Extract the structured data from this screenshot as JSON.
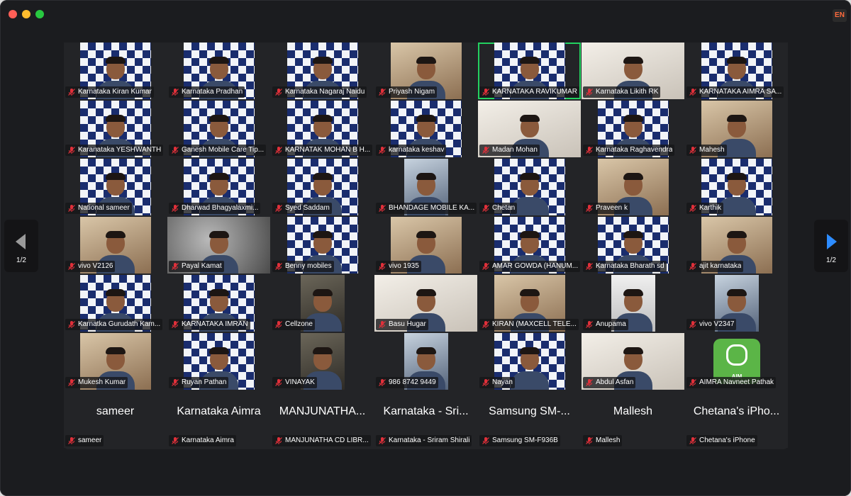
{
  "language_badge": "EN",
  "colors": {
    "mute_icon": "#e0303a",
    "active_speaker": "#23d160",
    "next_arrow": "#2d8cff",
    "prev_arrow": "#9a9a9a"
  },
  "pager": {
    "prev_page": "1/2",
    "next_page": "1/2"
  },
  "participants": [
    {
      "name": "Karnataka Kiran Kumar",
      "bg": "pattern"
    },
    {
      "name": "Karnataka Pradhan",
      "bg": "pattern"
    },
    {
      "name": "Karnataka Nagaraj Naidu",
      "bg": "pattern"
    },
    {
      "name": "Priyash Nigam",
      "bg": "warm"
    },
    {
      "name": "KARNATAKA RAVIKUMAR",
      "bg": "pattern",
      "speaking": true
    },
    {
      "name": "Karnataka Likith RK",
      "bg": "bright"
    },
    {
      "name": "KARNATAKA AIMRA SA...",
      "bg": "pattern"
    },
    {
      "name": "Karanataka YESHWANTH",
      "bg": "pattern"
    },
    {
      "name": "Ganesh Mobile Care Tip...",
      "bg": "pattern"
    },
    {
      "name": "KARNATAK MOHAN B H...",
      "bg": "pattern"
    },
    {
      "name": "karnataka keshav",
      "bg": "pattern"
    },
    {
      "name": "Madan Mohan",
      "bg": "bright"
    },
    {
      "name": "Karnataka Raghavendra",
      "bg": "pattern"
    },
    {
      "name": "Mahesh",
      "bg": "warm"
    },
    {
      "name": "National sameer",
      "bg": "pattern"
    },
    {
      "name": "Dharwad Bhagyalaxmi...",
      "bg": "pattern"
    },
    {
      "name": "Syed Saddam",
      "bg": "pattern"
    },
    {
      "name": "BHANDAGE MOBILE  KA...",
      "bg": "shop"
    },
    {
      "name": "Chetan",
      "bg": "pattern"
    },
    {
      "name": "Praveen k",
      "bg": "warm"
    },
    {
      "name": "Karthik",
      "bg": "pattern"
    },
    {
      "name": "vivo V2126",
      "bg": "warm"
    },
    {
      "name": "Payal Kamat",
      "bg": "blurred"
    },
    {
      "name": "Benny mobiles",
      "bg": "pattern"
    },
    {
      "name": "vivo 1935",
      "bg": "warm"
    },
    {
      "name": "AMAR GOWDA (HANUM...",
      "bg": "pattern"
    },
    {
      "name": "Karnataka Bharath sd",
      "bg": "pattern"
    },
    {
      "name": "ajit karnataka",
      "bg": "warm"
    },
    {
      "name": "Karnatka Gurudath Kam...",
      "bg": "pattern"
    },
    {
      "name": "KARNATAKA IMRAN",
      "bg": "pattern"
    },
    {
      "name": "Cellzone",
      "bg": "dim"
    },
    {
      "name": "Basu Hugar",
      "bg": "bright"
    },
    {
      "name": "KIRAN (MAXCELL TELE...",
      "bg": "warm"
    },
    {
      "name": "Anupama",
      "bg": "ceiling"
    },
    {
      "name": "vivo V2347",
      "bg": "shop"
    },
    {
      "name": "Mukesh Kumar",
      "bg": "warm"
    },
    {
      "name": "Ruyan Pathan",
      "bg": "pattern"
    },
    {
      "name": "VINAYAK",
      "bg": "dim"
    },
    {
      "name": "986 8742 9449",
      "bg": "shop"
    },
    {
      "name": "Nayan",
      "bg": "pattern"
    },
    {
      "name": "Abdul Asfan",
      "bg": "bright"
    },
    {
      "name": "AIMRA Navneet Pathak",
      "bg": "aimra",
      "logo_text": "AIM"
    },
    {
      "name": "sameer",
      "big": "sameer",
      "bg": "none"
    },
    {
      "name": "Karnataka Aimra",
      "big": "Karnataka Aimra",
      "bg": "none"
    },
    {
      "name": "MANJUNATHA CD LIBR...",
      "big": "MANJUNATHA...",
      "bg": "none"
    },
    {
      "name": "Karnataka - Sriram Shirali",
      "big": "Karnataka - Sri...",
      "bg": "none"
    },
    {
      "name": "Samsung SM-F936B",
      "big": "Samsung SM-...",
      "bg": "none"
    },
    {
      "name": "Mallesh",
      "big": "Mallesh",
      "bg": "none"
    },
    {
      "name": "Chetana's iPhone",
      "big": "Chetana's iPho...",
      "bg": "none"
    }
  ]
}
